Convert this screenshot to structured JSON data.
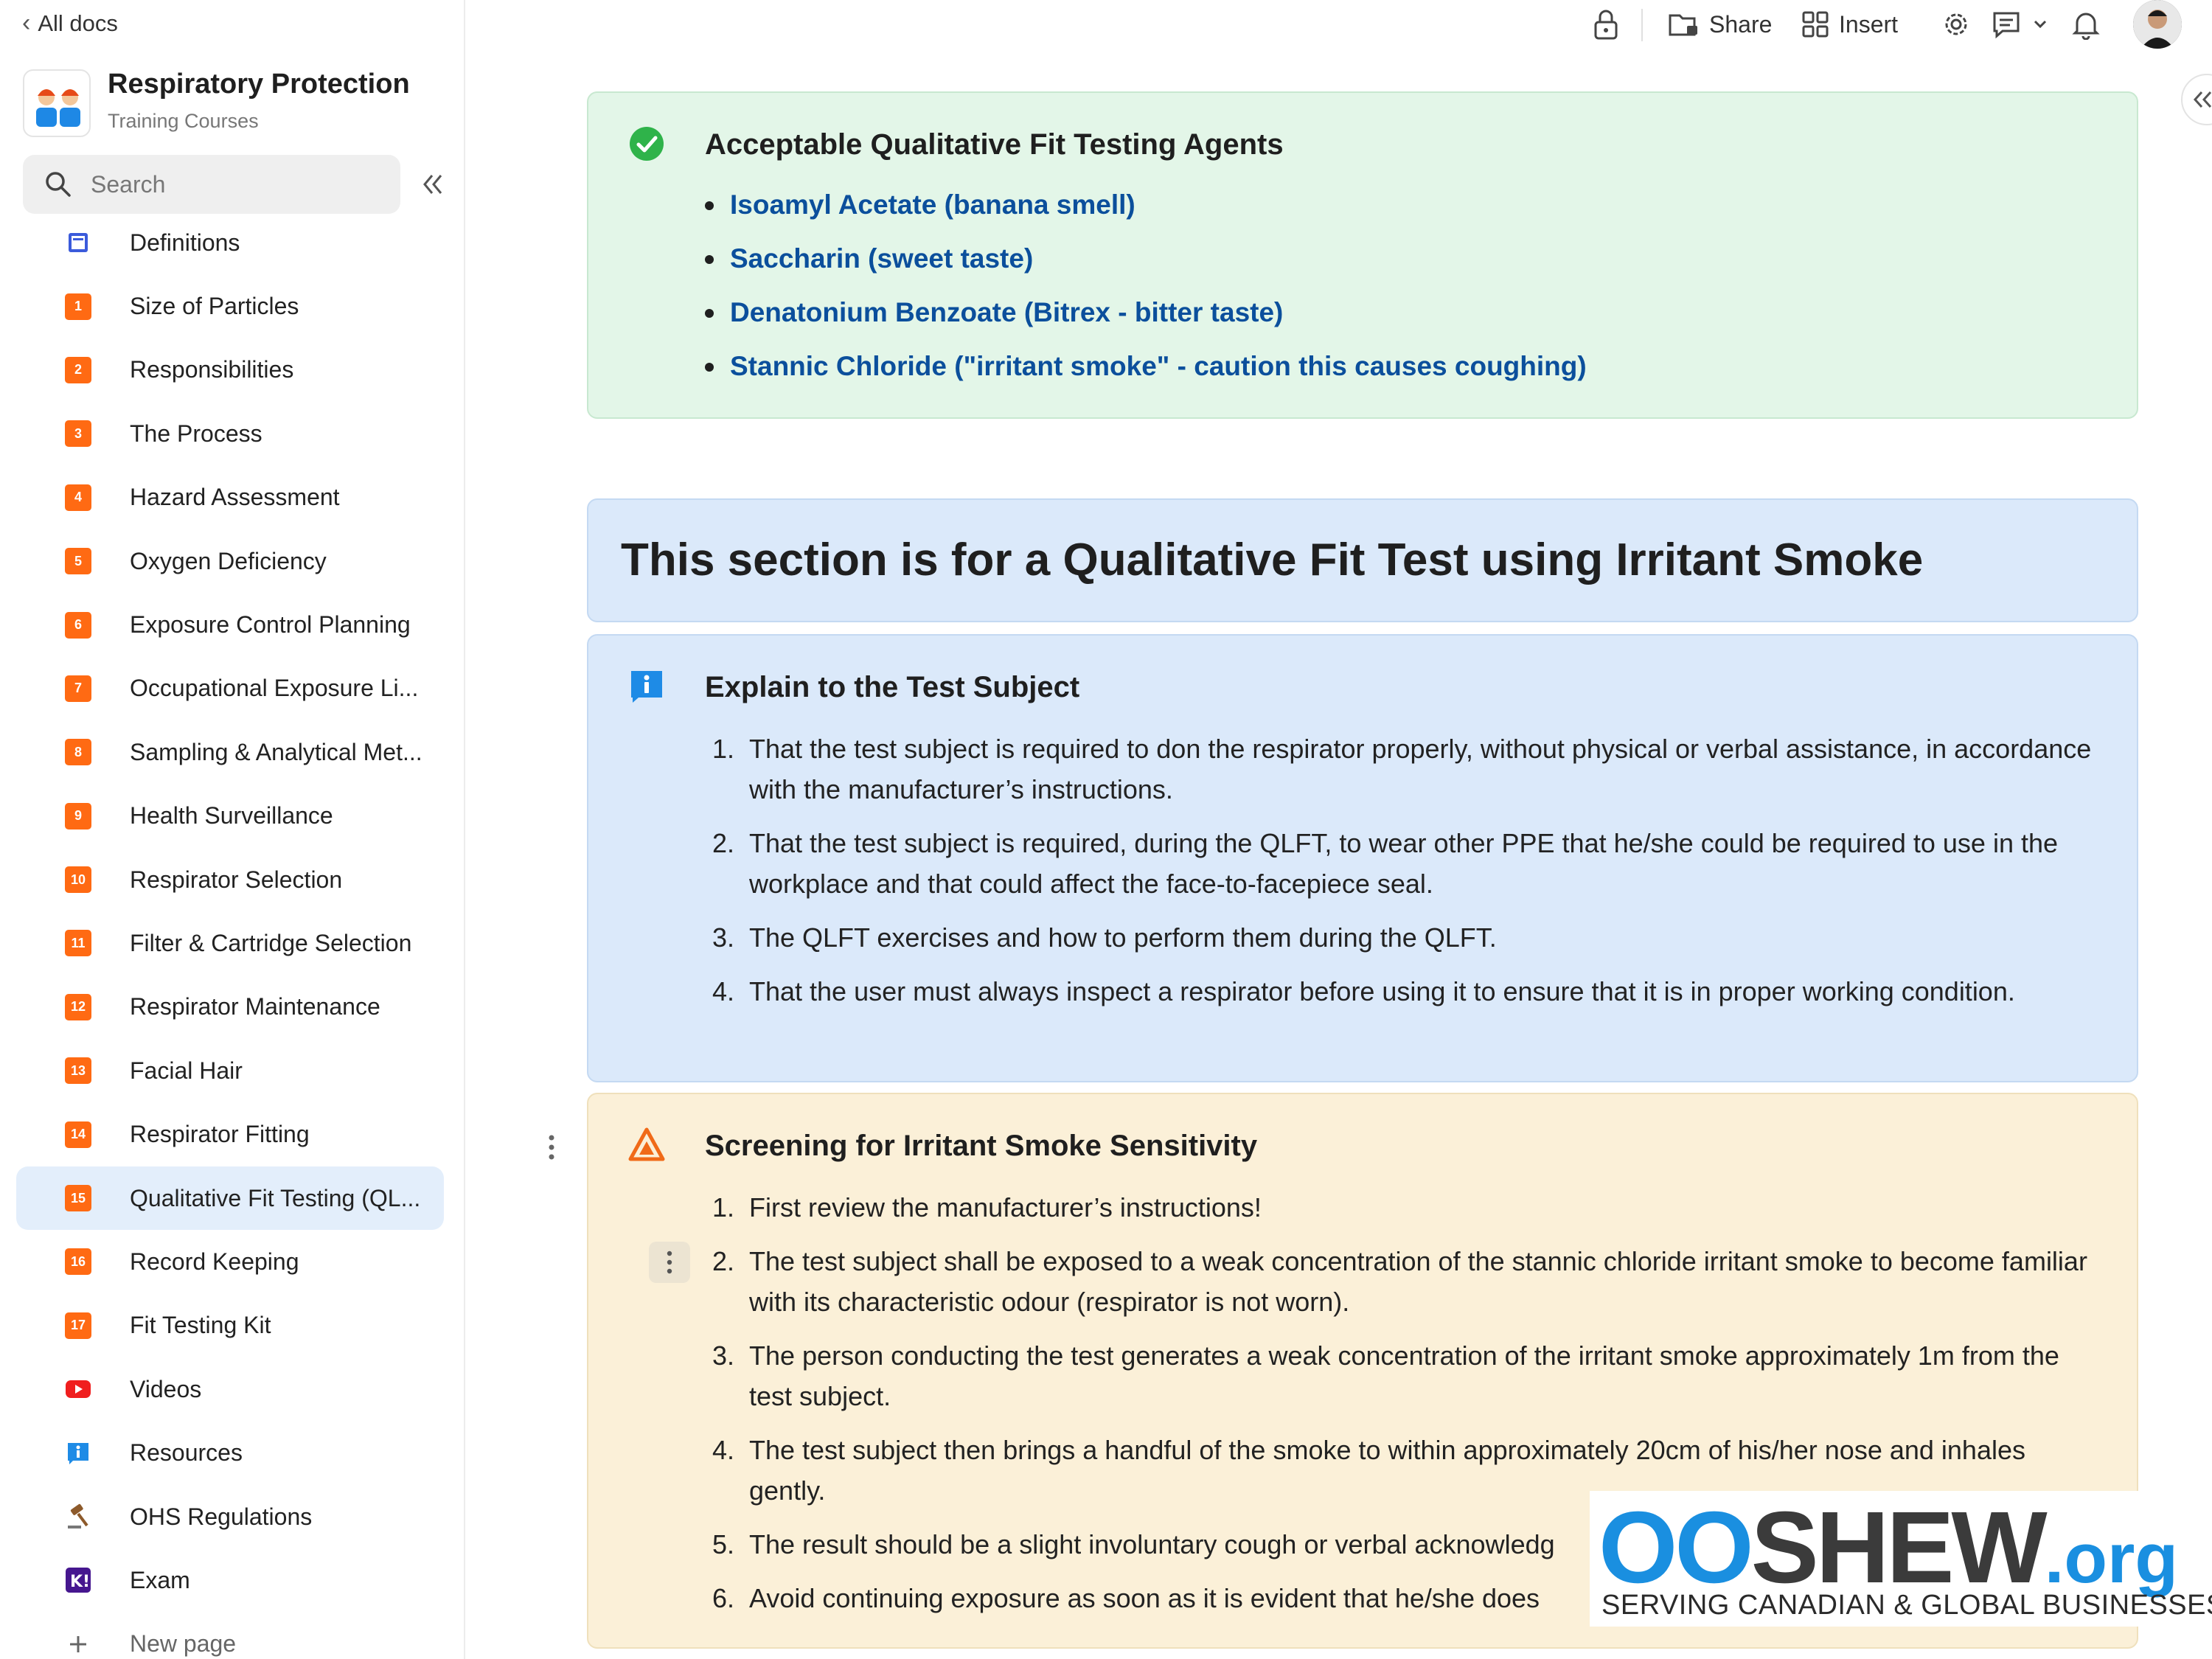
{
  "sidebar": {
    "back_label": "All docs",
    "doc_title": "Respiratory Protection",
    "doc_subtitle": "Training Courses",
    "search_placeholder": "Search",
    "new_page_label": "New page",
    "items": [
      {
        "badge": "",
        "icon": "book-icon",
        "label": "Definitions"
      },
      {
        "badge": "1",
        "label": "Size of Particles"
      },
      {
        "badge": "2",
        "label": "Responsibilities"
      },
      {
        "badge": "3",
        "label": "The Process"
      },
      {
        "badge": "4",
        "label": "Hazard Assessment"
      },
      {
        "badge": "5",
        "label": "Oxygen Deficiency"
      },
      {
        "badge": "6",
        "label": "Exposure Control Planning"
      },
      {
        "badge": "7",
        "label": "Occupational Exposure Li..."
      },
      {
        "badge": "8",
        "label": "Sampling & Analytical Met..."
      },
      {
        "badge": "9",
        "label": "Health Surveillance"
      },
      {
        "badge": "10",
        "label": "Respirator Selection"
      },
      {
        "badge": "11",
        "label": "Filter & Cartridge Selection"
      },
      {
        "badge": "12",
        "label": "Respirator Maintenance"
      },
      {
        "badge": "13",
        "label": "Facial Hair"
      },
      {
        "badge": "14",
        "label": "Respirator Fitting"
      },
      {
        "badge": "15",
        "label": "Qualitative Fit Testing (QL..."
      },
      {
        "badge": "16",
        "label": "Record Keeping"
      },
      {
        "badge": "17",
        "label": "Fit Testing Kit"
      },
      {
        "badge": "",
        "icon": "youtube-icon",
        "label": "Videos"
      },
      {
        "badge": "",
        "icon": "info-icon",
        "label": "Resources"
      },
      {
        "badge": "",
        "icon": "gavel-icon",
        "label": "OHS Regulations"
      },
      {
        "badge": "",
        "icon": "kahoot-icon",
        "label": "Exam"
      }
    ],
    "active_index": 15
  },
  "topbar": {
    "share_label": "Share",
    "insert_label": "Insert"
  },
  "agents": {
    "title": "Acceptable Qualitative Fit Testing Agents",
    "items": [
      "Isoamyl Acetate (banana smell)",
      "Saccharin (sweet taste)",
      "Denatonium Benzoate (Bitrex - bitter taste)",
      "Stannic Chloride (\"irritant smoke\" - caution this causes coughing)"
    ]
  },
  "section_heading": "This section is for a Qualitative Fit Test using Irritant Smoke",
  "explain": {
    "title": "Explain to the Test Subject",
    "items": [
      "That the test subject is required to don the respirator properly, without physical or verbal assistance, in accordance with the manufacturer’s instructions.",
      "That the test subject is required, during the QLFT, to wear other PPE that he/she could be required to use in the workplace and that could affect the face-to-facepiece seal.",
      "The QLFT exercises and how to perform them during the QLFT.",
      "That the user must always inspect a respirator before using it to ensure that it is in proper working condition."
    ]
  },
  "screening": {
    "title": "Screening for Irritant Smoke Sensitivity",
    "items": [
      "First review the manufacturer’s instructions!",
      "The test subject shall be exposed to a weak concentration of the stannic chloride irritant smoke to become familiar with its characteristic odour (respirator is not worn).",
      "The person conducting the test generates a weak concentration of the irritant smoke approximately 1m from the test subject.",
      "The test subject then brings a handful of the smoke to within approximately 20cm of his/her nose and inhales gently.",
      "The result should be a slight involuntary cough or verbal acknowledg",
      "Avoid continuing exposure as soon as it is evident that he/she does"
    ]
  },
  "watermark": {
    "brand_oo": "OO",
    "brand_rest": "SHEW",
    "brand_tld": ".org",
    "tagline": "SERVING CANADIAN & GLOBAL BUSINESSES"
  },
  "colors": {
    "badge": "#ff6a13",
    "link": "#0b4f9c",
    "success": "#2fb34a",
    "info": "#1e8be6",
    "warning": "#f06a18",
    "brand": "#1a8fe0"
  }
}
